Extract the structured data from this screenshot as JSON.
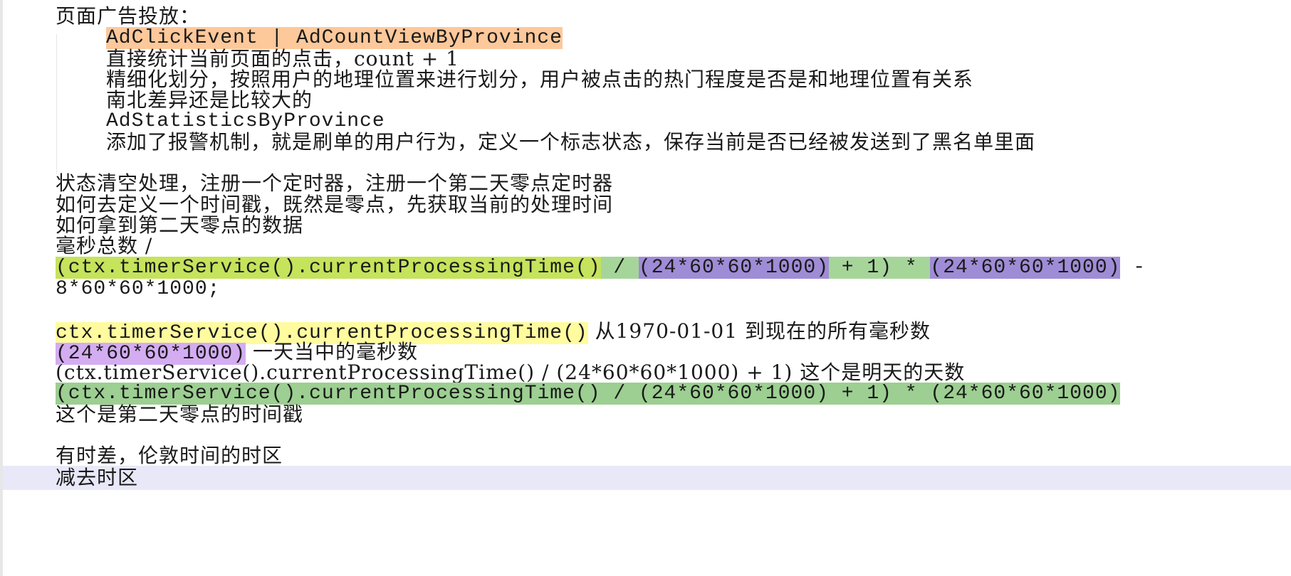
{
  "document": {
    "lines": [
      {
        "text": "页面广告投放："
      },
      {
        "segments": [
          "AdClickEvent | AdCountViewByProvince"
        ]
      },
      {
        "text": "直接统计当前页面的点击，count + 1"
      },
      {
        "text": "精细化划分，按照用户的地理位置来进行划分，用户被点击的热门程度是否是和地理位置有关系"
      },
      {
        "text": "南北差异还是比较大的"
      },
      {
        "text": "AdStatisticsByProvince"
      },
      {
        "text": "添加了报警机制，就是刷单的用户行为，定义一个标志状态，保存当前是否已经被发送到了黑名单里面"
      },
      {
        "text": ""
      },
      {
        "text": "状态清空处理，注册一个定时器，注册一个第二天零点定时器"
      },
      {
        "text": "如何去定义一个时间戳，既然是零点，先获取当前的处理时间"
      },
      {
        "text": "如何拿到第二天零点的数据"
      },
      {
        "text": "毫秒总数 /"
      },
      {
        "segments": [
          "(ctx.timerService().currentProcessingTime()",
          " / ",
          "(24*60*60*1000)",
          " + 1) * ",
          "(24*60*60*1000)",
          " -"
        ]
      },
      {
        "text": "8*60*60*1000;"
      },
      {
        "text": ""
      },
      {
        "segments": [
          "ctx.timerService().currentProcessingTime()",
          " 从1970-01-01 到现在的所有毫秒数"
        ]
      },
      {
        "segments": [
          "(24*60*60*1000)",
          " 一天当中的毫秒数"
        ]
      },
      {
        "text": "(ctx.timerService().currentProcessingTime() / (24*60*60*1000) + 1) 这个是明天的天数"
      },
      {
        "segments": [
          "(ctx.timerService().currentProcessingTime() / (24*60*60*1000) + 1) * (24*60*60*1000)"
        ]
      },
      {
        "text": "这个是第二天零点的时间戳"
      },
      {
        "text": ""
      },
      {
        "text": "有时差，伦敦时间的时区"
      },
      {
        "text": "减去时区"
      }
    ]
  },
  "colors": {
    "orange_highlight": "#fdc89a",
    "lime_highlight": "#c5e35b",
    "green_highlight": "#a6d59a",
    "purple_highlight": "#9f8cd6",
    "yellow_highlight": "#fffb9e",
    "lilac_highlight": "#d4acf2",
    "current_line": "#e8e8f8"
  }
}
